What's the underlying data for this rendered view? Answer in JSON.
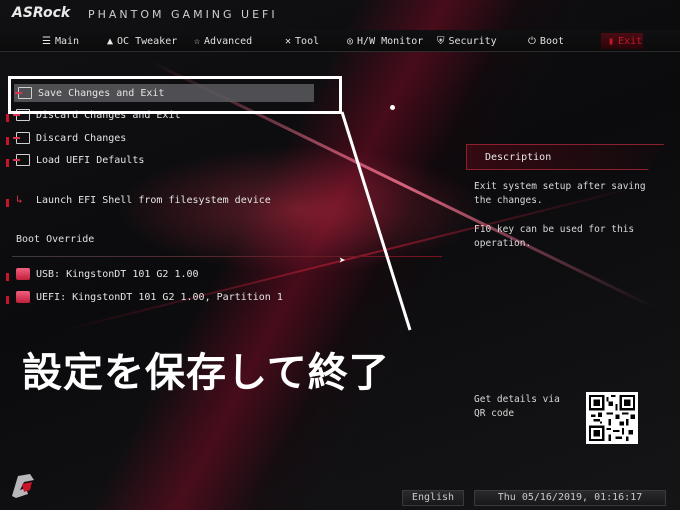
{
  "brand": {
    "name": "ASRock",
    "product": "PHANTOM GAMING UEFI"
  },
  "nav": [
    {
      "label": "Main",
      "icon": "list-icon"
    },
    {
      "label": "OC Tweaker",
      "icon": "rocket-icon"
    },
    {
      "label": "Advanced",
      "icon": "star-icon"
    },
    {
      "label": "Tool",
      "icon": "tools-icon"
    },
    {
      "label": "H/W Monitor",
      "icon": "monitor-icon"
    },
    {
      "label": "Security",
      "icon": "shield-icon"
    },
    {
      "label": "Boot",
      "icon": "power-icon"
    },
    {
      "label": "Exit",
      "icon": "exit-icon"
    }
  ],
  "menu": {
    "items": [
      "Save Changes and Exit",
      "Discard Changes and Exit",
      "Discard Changes",
      "Load UEFI Defaults",
      "Launch EFI Shell from filesystem device"
    ],
    "boot_override_title": "Boot Override",
    "boot_devices": [
      "USB: KingstonDT 101 G2 1.00",
      "UEFI: KingstonDT 101 G2 1.00, Partition 1"
    ]
  },
  "description": {
    "title": "Description",
    "line1": "Exit system setup after saving the changes.",
    "line2": "F10 key can be used for this operation."
  },
  "qr": {
    "text": "Get details via QR code"
  },
  "caption": "設定を保存して終了",
  "footer": {
    "language": "English",
    "datetime": "Thu 05/16/2019, 01:16:17"
  },
  "colors": {
    "accent": "#c8142a",
    "background": "#0a0a0b",
    "text": "#d8d8d8"
  }
}
